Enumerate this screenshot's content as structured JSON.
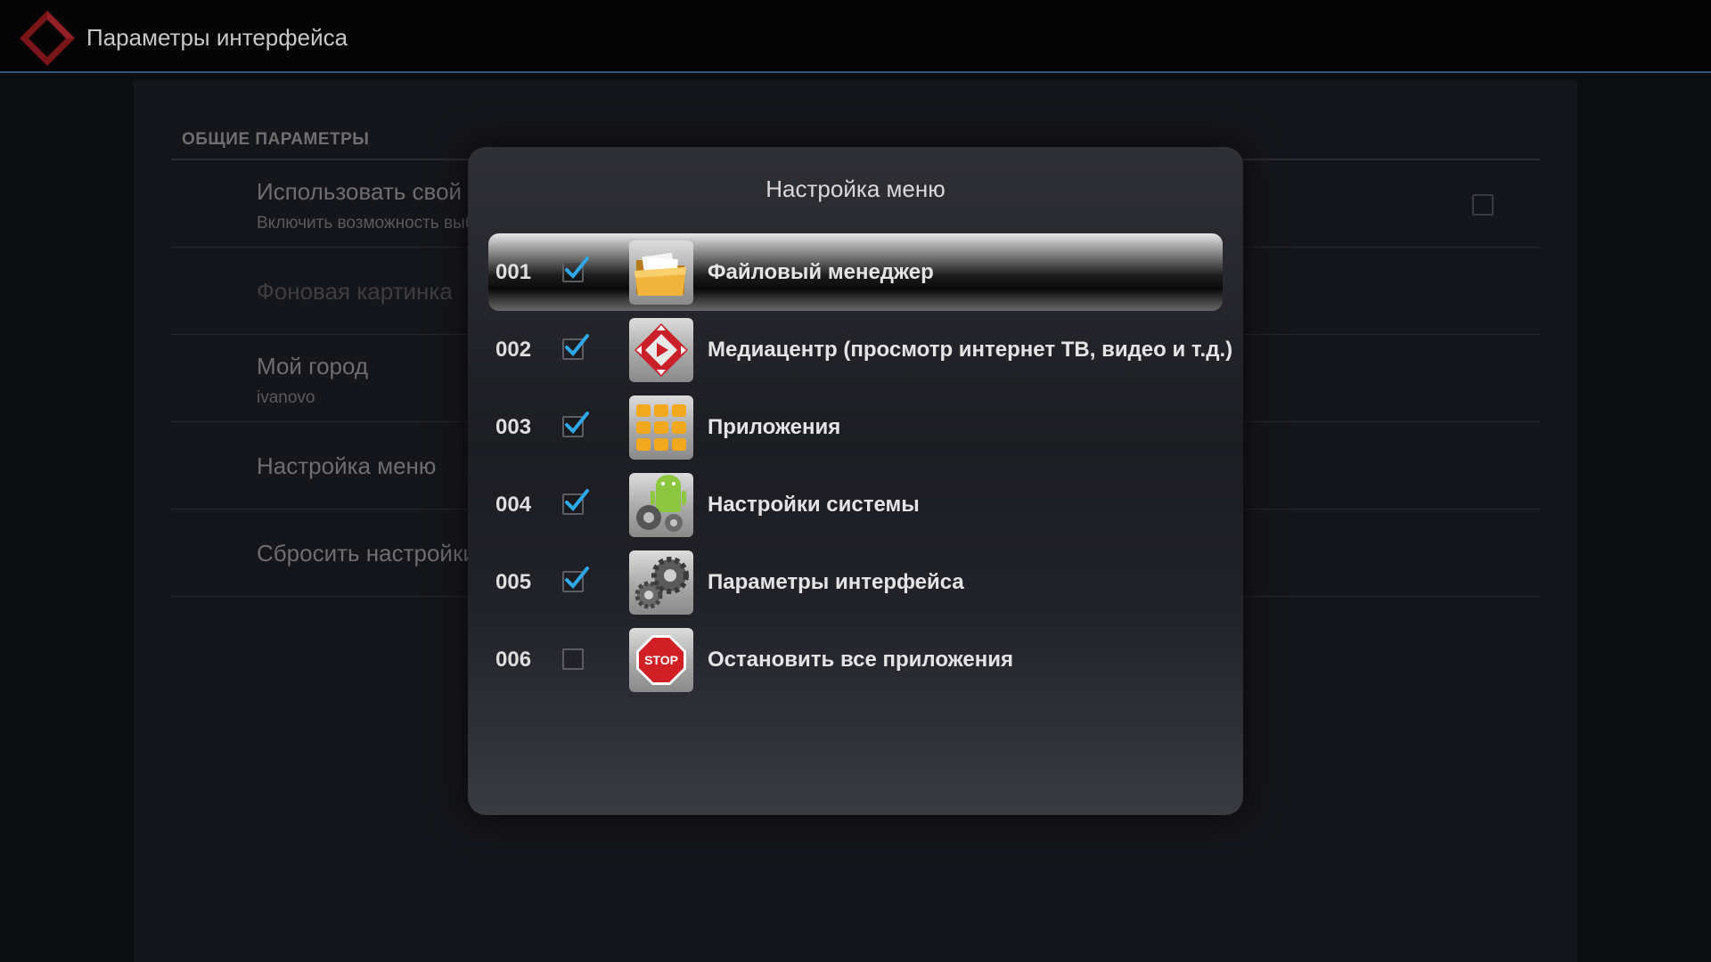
{
  "action_bar": {
    "title": "Параметры интерфейса",
    "logo_icon": "red-diamond-logo-icon",
    "accent_color": "#2e5878"
  },
  "preferences": {
    "section_header": "ОБЩИЕ ПАРАМЕТРЫ",
    "rows": [
      {
        "title": "Использовать свой фон",
        "summary": "Включить возможность выбора фона главного меню",
        "checked": false
      },
      {
        "title": "Фоновая картинка",
        "summary": "",
        "disabled": true
      },
      {
        "title": "Мой город",
        "summary": "ivanovo"
      },
      {
        "title": "Настройка меню",
        "summary": ""
      },
      {
        "title": "Сбросить настройки меню",
        "summary": ""
      }
    ]
  },
  "dialog": {
    "title": "Настройка меню",
    "items": [
      {
        "number": "001",
        "label": "Файловый менеджер",
        "checked": true,
        "icon": "folder-icon",
        "selected": true
      },
      {
        "number": "002",
        "label": "Медиацентр (просмотр интернет ТВ, видео и т.д.)",
        "checked": true,
        "icon": "mediacenter-icon",
        "selected": false
      },
      {
        "number": "003",
        "label": "Приложения",
        "checked": true,
        "icon": "apps-grid-icon",
        "selected": false
      },
      {
        "number": "004",
        "label": "Настройки системы",
        "checked": true,
        "icon": "android-settings-icon",
        "selected": false
      },
      {
        "number": "005",
        "label": "Параметры интерфейса",
        "checked": true,
        "icon": "gears-icon",
        "selected": false
      },
      {
        "number": "006",
        "label": "Остановить все приложения",
        "checked": false,
        "icon": "stop-sign-icon",
        "selected": false
      },
      {
        "icon_text_stop": "STOP"
      }
    ]
  },
  "colors": {
    "checkmark": "#2ea8e6",
    "logo_red": "#8e1b1f"
  }
}
